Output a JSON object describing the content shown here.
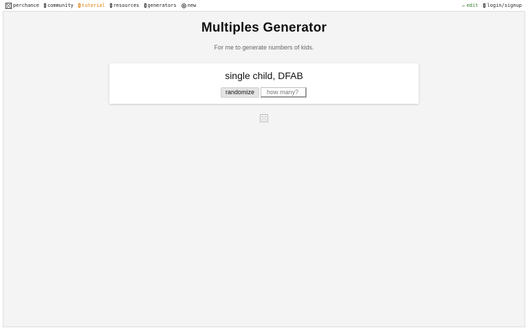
{
  "nav": {
    "left": [
      {
        "label": "perchance",
        "icon": "dice-icon"
      },
      {
        "label": "community",
        "icon": "box-icon"
      },
      {
        "label": "tutorial",
        "icon": "box-icon"
      },
      {
        "label": "resources",
        "icon": "box-icon"
      },
      {
        "label": "generators",
        "icon": "box-icon"
      },
      {
        "label": "new",
        "icon": "plus-circle-icon"
      }
    ],
    "right": [
      {
        "label": "edit",
        "icon": "pencil-icon",
        "icon_glyph": "✏"
      },
      {
        "label": "login/signup",
        "icon": "box-icon"
      }
    ],
    "tutorial_color": "#e07b00",
    "edit_color": "#2a7a2a"
  },
  "page": {
    "title": "Multiples Generator",
    "subtitle": "For me to generate numbers of kids."
  },
  "generator": {
    "output": "single child, DFAB",
    "randomize_label": "randomize",
    "count_placeholder": "how many?",
    "count_value": ""
  },
  "footer": {
    "icon": "dice-icon"
  }
}
